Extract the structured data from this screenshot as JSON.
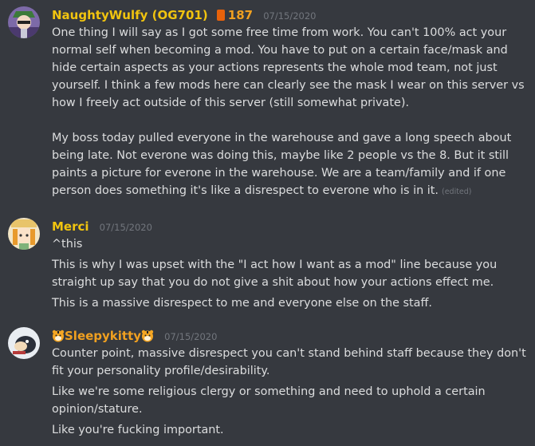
{
  "messages": [
    {
      "author": "NaughtyWulfy (OG701)",
      "badge_count": "187",
      "timestamp": "07/15/2020",
      "paragraphs": [
        "One thing I will say as I got some free time from work. You can't 100% act your normal self when becoming a mod. You have to put on a certain face/mask and hide certain aspects as your actions represents the whole mod team, not just yourself. I think a few mods here can clearly see the mask I wear on this server vs how I freely act outside of this server (still somewhat private).",
        "My boss today pulled everyone in the warehouse and gave a long speech about being late. Not everone was doing this, maybe like 2 people vs the 8. But it still paints a picture for everone in the warehouse. We are a team/family and if one person does something it's like a disrespect to everone who is in it."
      ],
      "edited_label": "(edited)"
    },
    {
      "author": "Merci",
      "timestamp": "07/15/2020",
      "lines": [
        "^this",
        "This is why I was upset with the \"I act how I want as a mod\" line because you straight up say that you do not give a shit about how your actions effect me.",
        "This is a massive disrespect to me and everyone else on the staff."
      ]
    },
    {
      "author": "Sleepykitty",
      "timestamp": "07/15/2020",
      "lines": [
        "Counter point, massive disrespect you can't stand behind staff because they don't fit your personality profile/desirability.",
        "Like we're some religious clergy or something and need to uphold a certain opinion/stature.",
        "Like you're fucking important."
      ]
    }
  ],
  "colors": {
    "background": "#36393f",
    "text": "#dcddde",
    "timestamp": "#72767d",
    "username_gold": "#f1c40f",
    "username_orange": "#f0a020"
  },
  "icons": {
    "badge": "orange-book-icon",
    "name_emoji": "tiger-face-icon"
  }
}
